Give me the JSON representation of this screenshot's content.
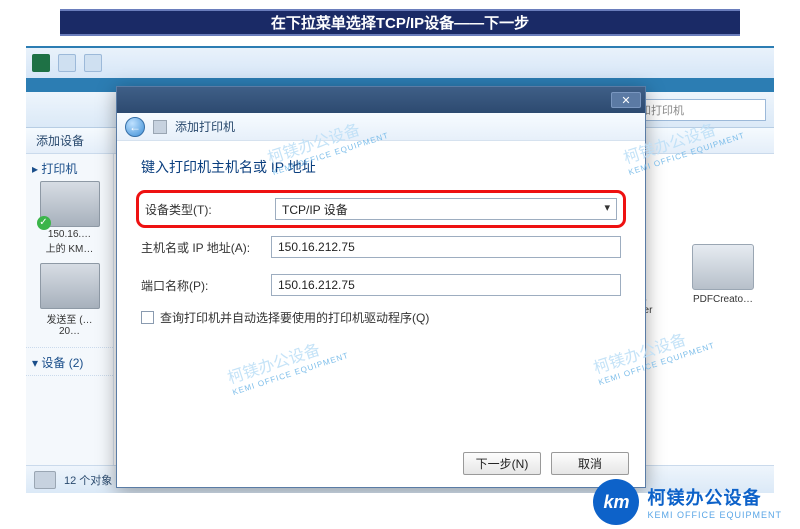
{
  "slide": {
    "title": "在下拉菜单选择TCP/IP设备——下一步"
  },
  "explorer": {
    "search_placeholder": "搜索 设备和打印机",
    "toolbar_label": "添加设备",
    "side_header_printers": "▸ 打印机",
    "side_header_devices": "▾ 设备 (2)",
    "side_item1_line1": "150.16.…",
    "side_item1_line2": "上的 KM…",
    "side_item2_line1": "发送至 (…",
    "side_item2_line2": "20…",
    "right_printer1": "Microsoft XPS Document Writer",
    "right_printer2": "PDFCreato…",
    "status_text": "12 个对象"
  },
  "wizard": {
    "breadcrumb": "添加打印机",
    "heading": "键入打印机主机名或 IP 地址",
    "label_type": "设备类型(T):",
    "value_type": "TCP/IP 设备",
    "label_host": "主机名或 IP 地址(A):",
    "value_host": "150.16.212.75",
    "label_port": "端口名称(P):",
    "value_port": "150.16.212.75",
    "checkbox_label": "查询打印机并自动选择要使用的打印机驱动程序(Q)",
    "btn_next": "下一步(N)",
    "btn_cancel": "取消"
  },
  "watermark": {
    "cn": "柯镁办公设备",
    "en": "KEMI OFFICE EQUIPMENT"
  },
  "brand": {
    "logo_text": "km",
    "cn": "柯镁办公设备",
    "en": "KEMI OFFICE EQUIPMENT"
  }
}
